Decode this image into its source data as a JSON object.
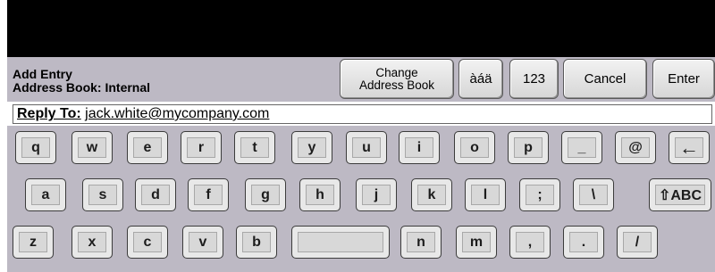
{
  "header": {
    "title": "Add Entry",
    "subtitle": "Address Book: Internal",
    "buttons": {
      "change_address_book_line1": "Change",
      "change_address_book_line2": "Address Book",
      "accents": "àáä",
      "numbers": "123",
      "cancel": "Cancel",
      "enter": "Enter"
    }
  },
  "reply": {
    "label": "Reply To:",
    "value": "jack.white@mycompany.com"
  },
  "keyboard": {
    "row1": [
      "q",
      "w",
      "e",
      "r",
      "t",
      "y",
      "u",
      "i",
      "o",
      "p",
      "_",
      "@",
      "←"
    ],
    "row2": [
      "a",
      "s",
      "d",
      "f",
      "g",
      "h",
      "j",
      "k",
      "l",
      ";",
      "\\",
      "⇧ABC"
    ],
    "row3": [
      "z",
      "x",
      "c",
      "v",
      "b",
      "",
      "n",
      "m",
      ",",
      ".",
      "/"
    ]
  }
}
